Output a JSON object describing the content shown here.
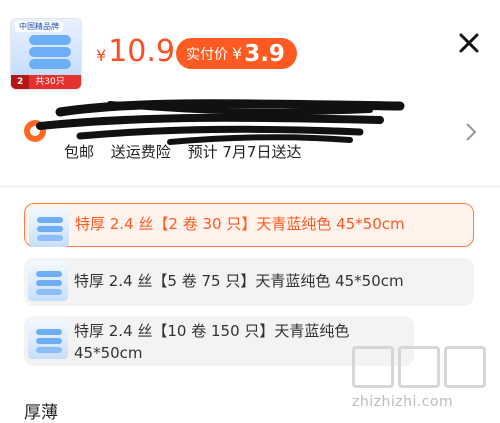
{
  "header": {
    "thumbnail": {
      "tag": "中国精品牌",
      "badge_count": "2",
      "badge_text": "共30只"
    },
    "price_symbol": "¥",
    "price": "10.9",
    "pay_pill": {
      "label": "实付价",
      "symbol": "¥",
      "value": "3.9"
    }
  },
  "address": {
    "icon": "location-pin-icon",
    "shipping": [
      "包邮",
      "送运费险",
      "预计 7月7日送达"
    ]
  },
  "options": [
    {
      "label": "特厚 2.4 丝【2 卷 30 只】天青蓝纯色 45*50cm",
      "selected": true
    },
    {
      "label": "特厚 2.4 丝【5 卷 75 只】天青蓝纯色 45*50cm",
      "selected": false
    },
    {
      "label": "特厚 2.4 丝【10 卷 150 只】天青蓝纯色 45*50cm",
      "selected": false
    }
  ],
  "section_title": "厚薄",
  "watermark": "zhizhizhi.com",
  "colors": {
    "accent": "#ff5a22",
    "selected_bg": "#fff3ec",
    "option_bg": "#f3f3f3"
  }
}
